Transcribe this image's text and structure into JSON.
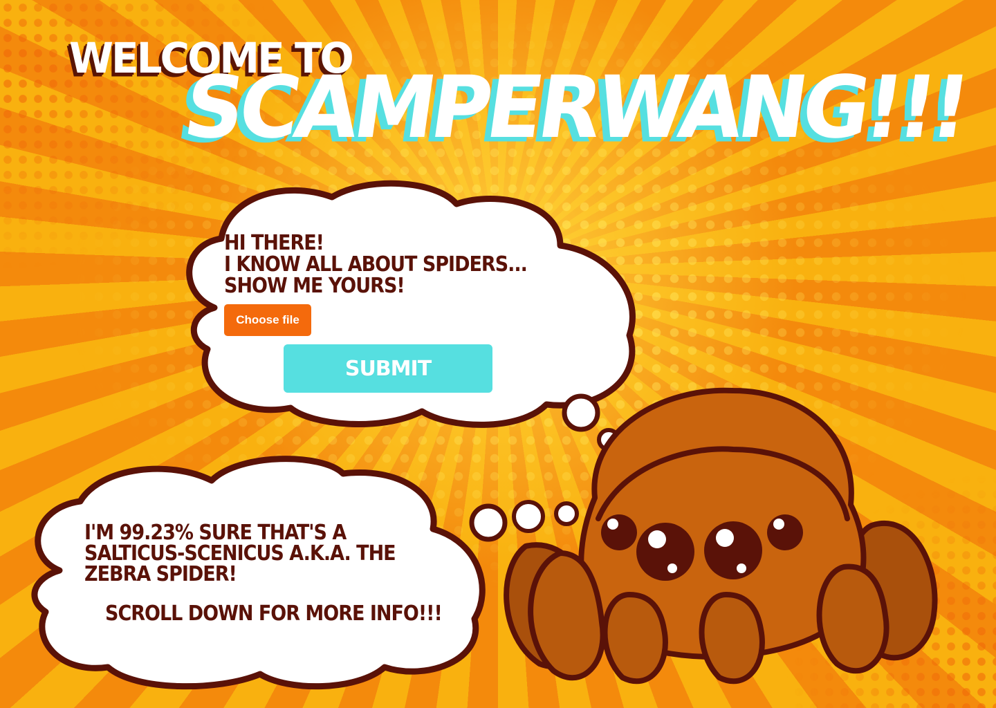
{
  "header": {
    "welcome": "WELCOME TO",
    "brand": "SCAMPERWANG!!!"
  },
  "upload_bubble": {
    "line1": "HI THERE!",
    "line2": "I KNOW ALL ABOUT SPIDERS...",
    "line3": "SHOW ME YOURS!",
    "choose_file_label": "Choose file",
    "submit_label": "SUBMIT"
  },
  "result_bubble": {
    "line1": "I'M 99.23% SURE THAT'S A",
    "line2": "SALTICUS-SCENICUS A.K.A. THE",
    "line3": "ZEBRA SPIDER!",
    "scroll_hint": "SCROLL DOWN FOR MORE INFO!!!"
  },
  "mascot": {
    "icon": "spider-mascot-icon"
  },
  "colors": {
    "accent_cyan": "#56dfe0",
    "accent_orange": "#f46a0c",
    "text_dark": "#5a1208",
    "background": "#f7a412",
    "spider_body": "#c9640e"
  }
}
